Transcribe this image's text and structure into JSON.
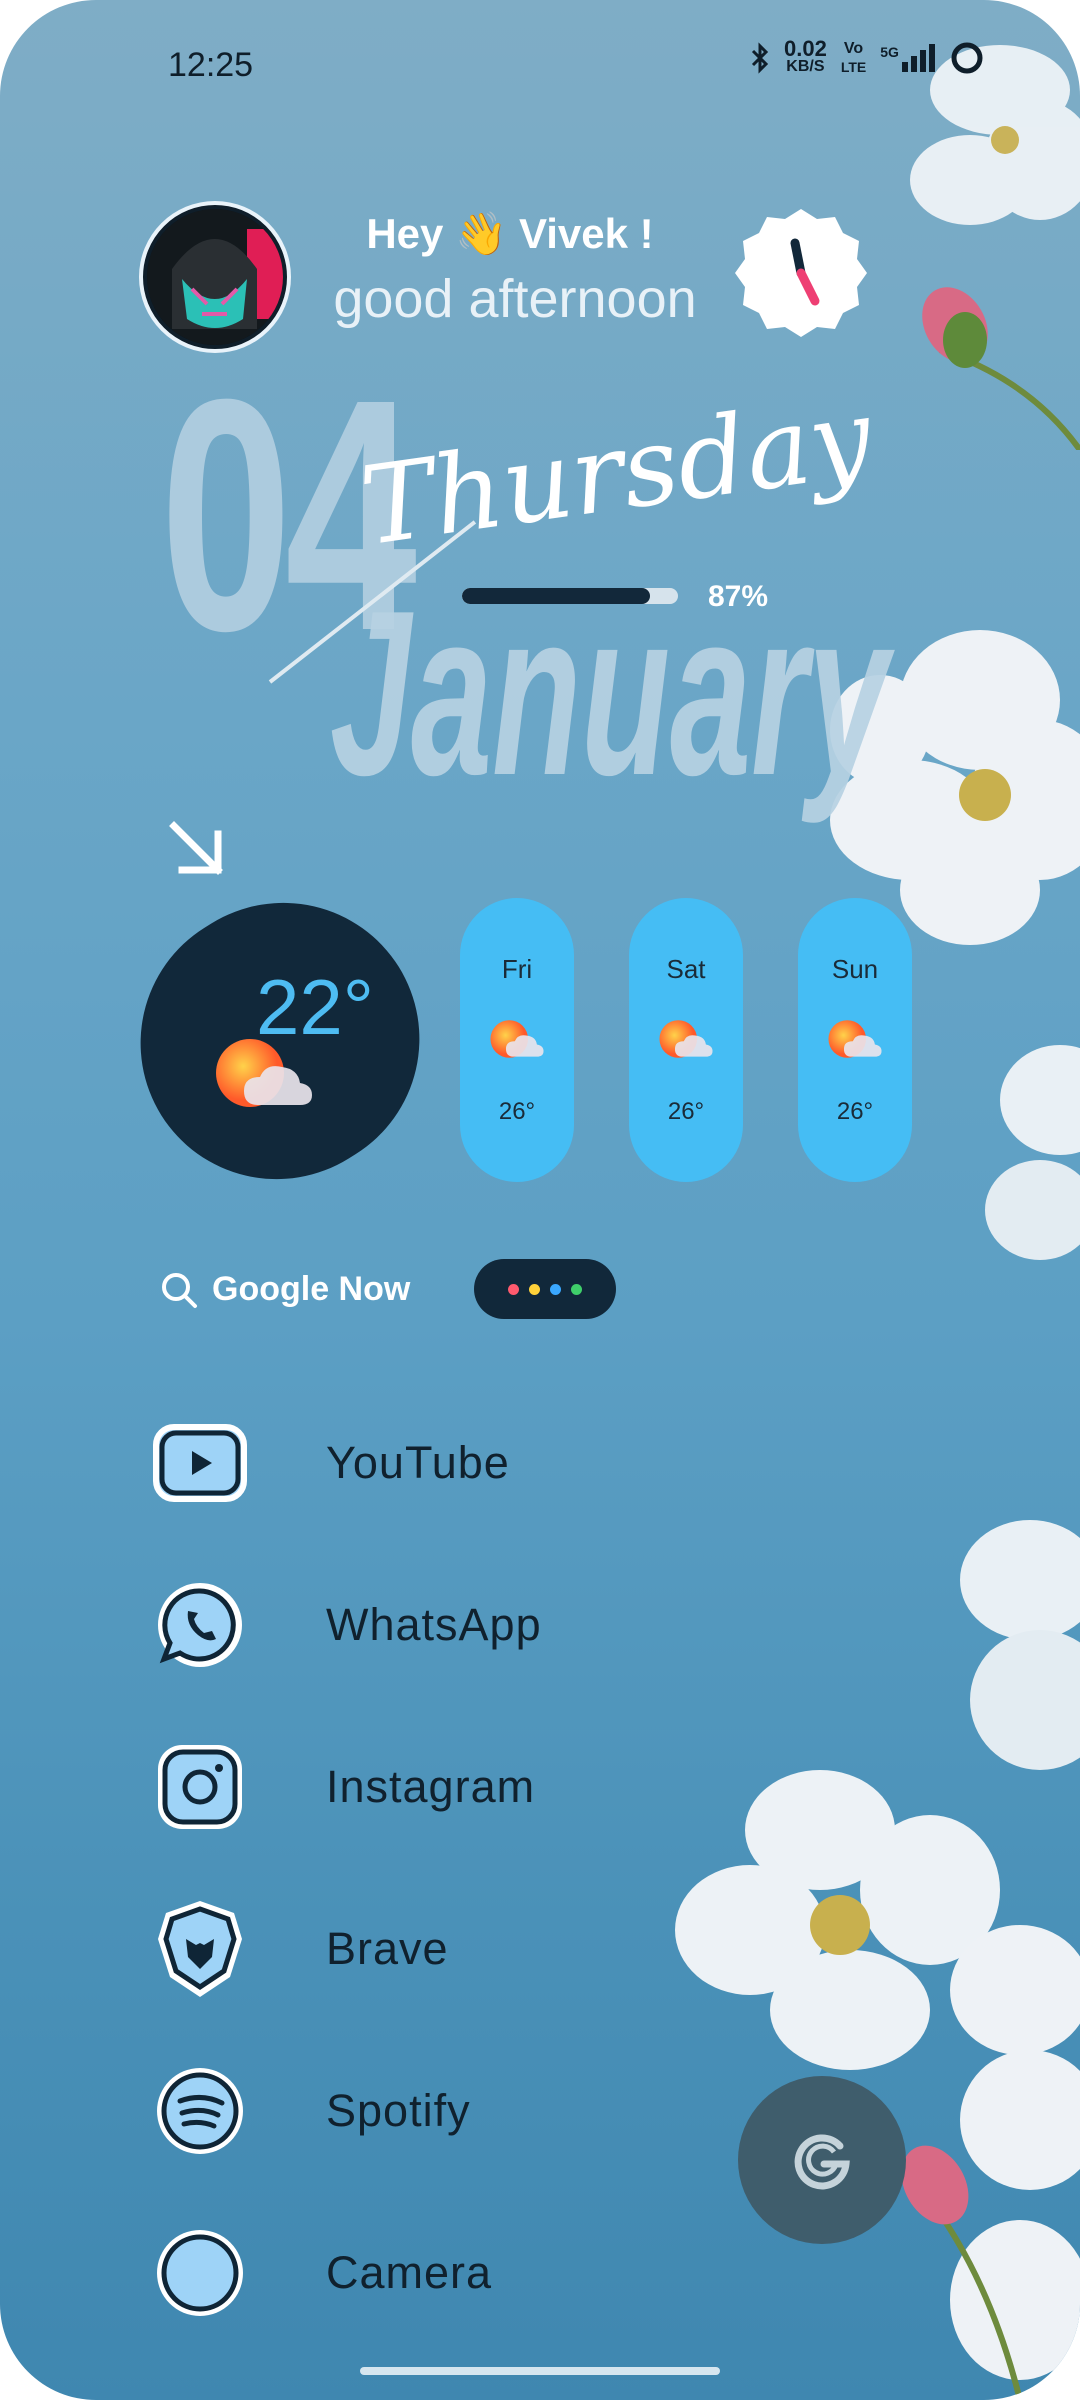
{
  "status_bar": {
    "time": "12:25",
    "speed_value": "0.02",
    "speed_unit": "KB/S",
    "volte_top": "Vo",
    "volte_bottom": "LTE",
    "network": "5G",
    "icons": [
      "bluetooth-icon",
      "signal-icon",
      "battery-ring-icon"
    ]
  },
  "greeting": {
    "name_line": "Hey 👋 Vivek !",
    "sub_line": "good afternoon"
  },
  "date": {
    "day_number": "04",
    "weekday": "Thursday",
    "month": "January"
  },
  "battery": {
    "level": 0.87,
    "label": "87%"
  },
  "weather": {
    "current_temp": "22°",
    "forecast": [
      {
        "day": "Fri",
        "temp": "26°"
      },
      {
        "day": "Sat",
        "temp": "26°"
      },
      {
        "day": "Sun",
        "temp": "26°"
      }
    ],
    "icon": "partly-cloudy-icon"
  },
  "search": {
    "label": "Google Now",
    "dot_colors": [
      "#ff5a6e",
      "#ffd23a",
      "#3aa8ff",
      "#3fcf6a"
    ]
  },
  "apps": [
    {
      "label": "YouTube",
      "icon": "youtube-icon"
    },
    {
      "label": "WhatsApp",
      "icon": "whatsapp-icon"
    },
    {
      "label": "Instagram",
      "icon": "instagram-icon"
    },
    {
      "label": "Brave",
      "icon": "brave-icon"
    },
    {
      "label": "Spotify",
      "icon": "spotify-icon"
    },
    {
      "label": "Camera",
      "icon": "camera-icon"
    }
  ],
  "colors": {
    "accent_dark": "#11283a",
    "weather_pill": "#45bdf4",
    "icon_fill": "#9ed3f7"
  }
}
